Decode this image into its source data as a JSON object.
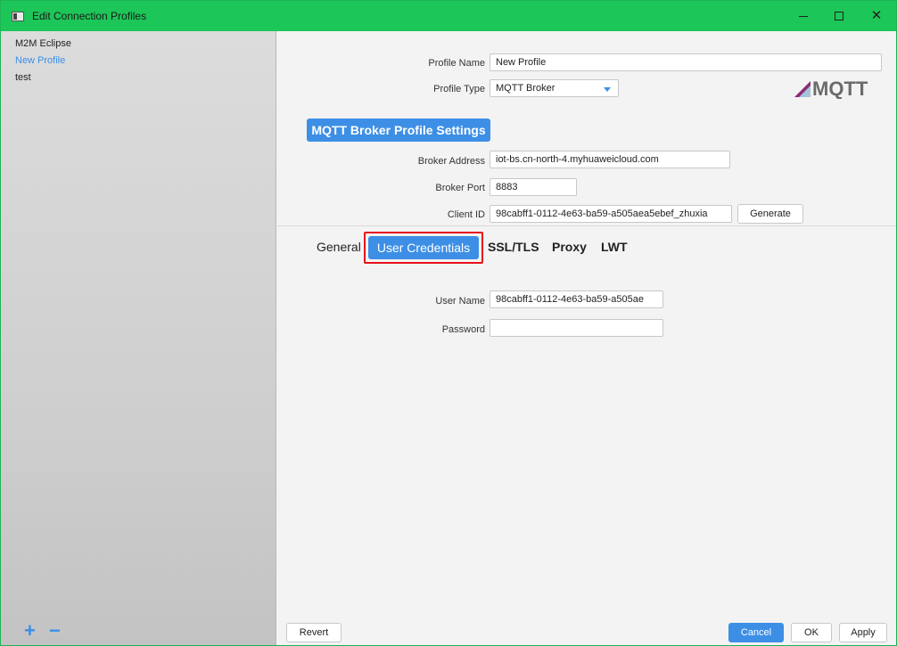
{
  "window": {
    "title": "Edit Connection Profiles"
  },
  "sidebar": {
    "items": [
      {
        "label": "M2M Eclipse",
        "selected": false
      },
      {
        "label": "New Profile",
        "selected": true
      },
      {
        "label": "test",
        "selected": false
      }
    ],
    "add_label": "+",
    "remove_label": "−"
  },
  "profile": {
    "name_label": "Profile Name",
    "name_value": "New Profile",
    "type_label": "Profile Type",
    "type_value": "MQTT Broker",
    "logo_text": "MQTT"
  },
  "broker": {
    "section_title": "MQTT Broker Profile Settings",
    "address_label": "Broker Address",
    "address_value": "iot-bs.cn-north-4.myhuaweicloud.com",
    "port_label": "Broker Port",
    "port_value": "8883",
    "client_id_label": "Client ID",
    "client_id_value": "98cabff1-0112-4e63-ba59-a505aea5ebef_zhuxia",
    "generate_label": "Generate"
  },
  "tabs": [
    {
      "label": "General",
      "active": false
    },
    {
      "label": "User Credentials",
      "active": true
    },
    {
      "label": "SSL/TLS",
      "active": false
    },
    {
      "label": "Proxy",
      "active": false
    },
    {
      "label": "LWT",
      "active": false
    }
  ],
  "credentials": {
    "username_label": "User Name",
    "username_value": "98cabff1-0112-4e63-ba59-a505ae",
    "password_label": "Password",
    "password_value": ""
  },
  "footer": {
    "revert_label": "Revert",
    "cancel_label": "Cancel",
    "ok_label": "OK",
    "apply_label": "Apply"
  },
  "colors": {
    "titlebar": "#1dc658",
    "accent": "#3d8fe6",
    "highlight": "#e8111d"
  }
}
